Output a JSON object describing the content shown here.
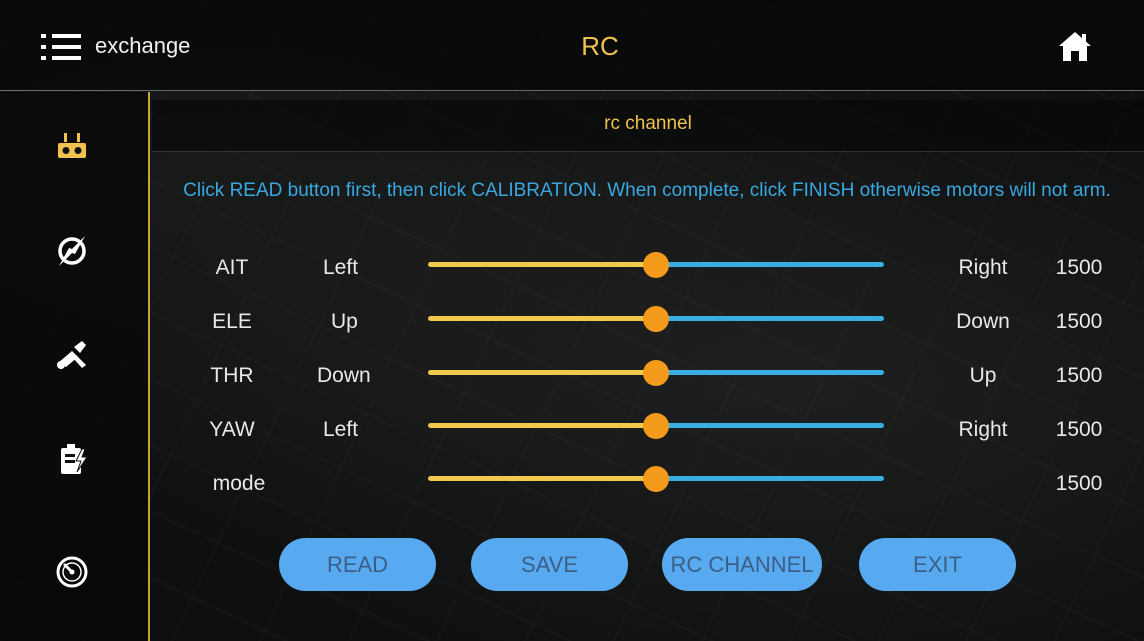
{
  "header": {
    "menu_label": "exchange",
    "title": "RC"
  },
  "sidebar": {
    "items": [
      {
        "icon": "rc-remote-icon",
        "active": true
      },
      {
        "icon": "compass-icon",
        "active": false
      },
      {
        "icon": "tools-icon",
        "active": false
      },
      {
        "icon": "battery-icon",
        "active": false
      },
      {
        "icon": "gauge-icon",
        "active": false
      }
    ]
  },
  "panel": {
    "title": "rc channel",
    "instructions": "Click READ button first, then click CALIBRATION. When complete, click FINISH otherwise motors will not arm."
  },
  "channels": [
    {
      "name": "AIT",
      "left": "Left",
      "right": "Right",
      "value": "1500",
      "position": 0.5
    },
    {
      "name": "ELE",
      "left": "Up",
      "right": "Down",
      "value": "1500",
      "position": 0.5
    },
    {
      "name": "THR",
      "left": "Down",
      "right": "Up",
      "value": "1500",
      "position": 0.5
    },
    {
      "name": "YAW",
      "left": "Left",
      "right": "Right",
      "value": "1500",
      "position": 0.5
    },
    {
      "name": "mode",
      "left": "",
      "right": "",
      "value": "1500",
      "position": 0.5
    }
  ],
  "buttons": {
    "read": "READ",
    "save": "SAVE",
    "rc_channel": "RC CHANNEL",
    "exit": "EXIT"
  },
  "colors": {
    "accent": "#f2c14e",
    "instruction": "#39a8e0",
    "slider_left": "#f2c94c",
    "slider_right": "#3aaee2",
    "knob": "#f59b1b",
    "button": "#58aaf0"
  }
}
